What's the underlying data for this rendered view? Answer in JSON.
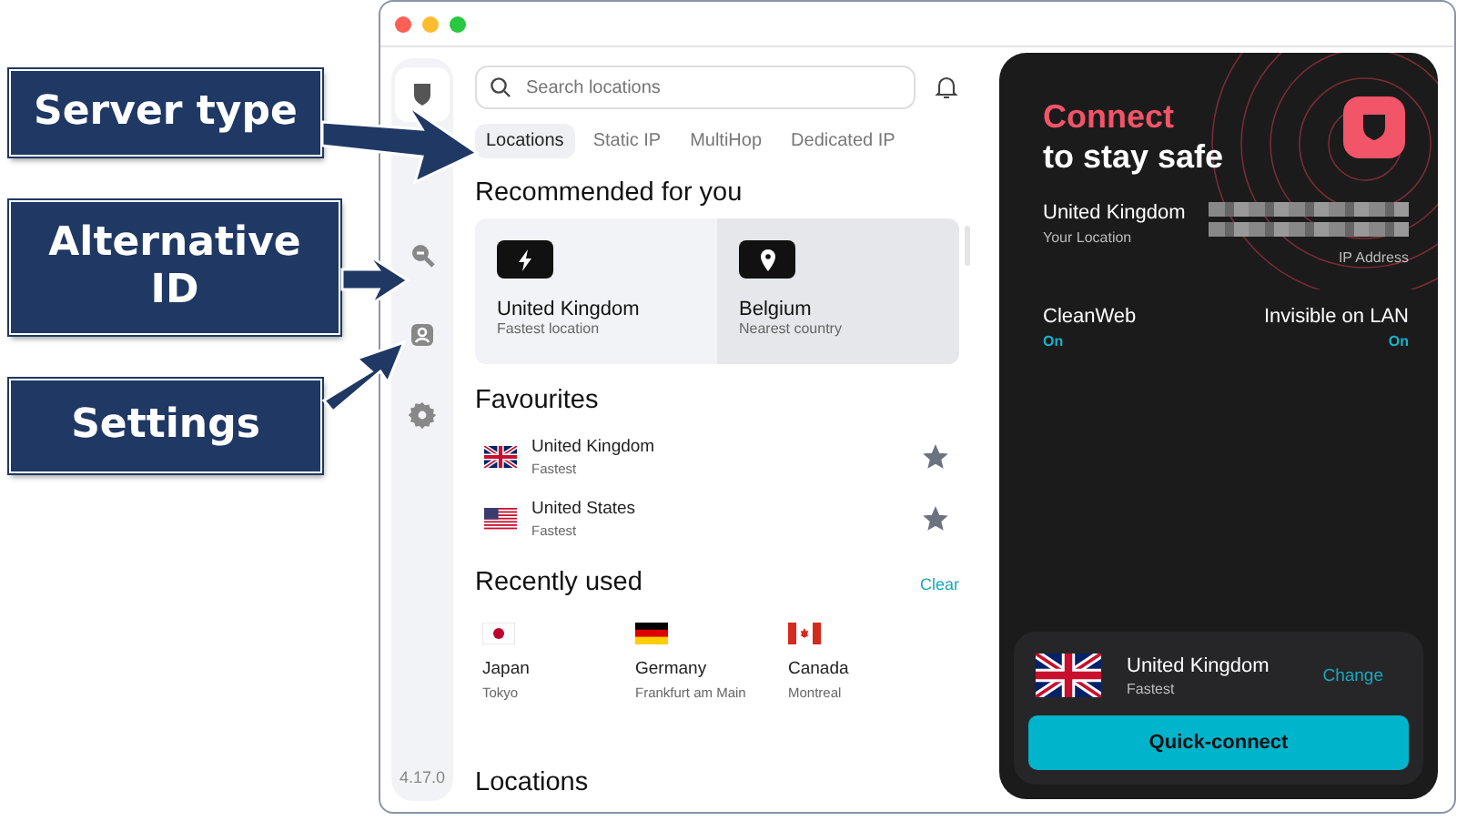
{
  "annotations": [
    {
      "label": "Server type"
    },
    {
      "label": "Alternative ID"
    },
    {
      "label": "Settings"
    }
  ],
  "sidebar": {
    "items": [
      {
        "kind": "shield",
        "selected": true
      },
      {
        "kind": "search",
        "selected": false
      },
      {
        "kind": "id",
        "selected": false
      },
      {
        "kind": "settings",
        "selected": false
      }
    ],
    "version": "4.17.0"
  },
  "search": {
    "placeholder": "Search locations"
  },
  "tabs": [
    {
      "label": "Locations",
      "selected": true
    },
    {
      "label": "Static IP",
      "selected": false
    },
    {
      "label": "MultiHop",
      "selected": false
    },
    {
      "label": "Dedicated IP",
      "selected": false
    }
  ],
  "recommended": {
    "title": "Recommended for you",
    "items": [
      {
        "kind": "fastest",
        "name": "United Kingdom",
        "detail": "Fastest location",
        "selected": false
      },
      {
        "kind": "nearest",
        "name": "Belgium",
        "detail": "Nearest country",
        "selected": true
      }
    ]
  },
  "favourites": {
    "title": "Favourites",
    "items": [
      {
        "kind": "gb",
        "name": "United Kingdom",
        "detail": "Fastest",
        "starred": true
      },
      {
        "kind": "us",
        "name": "United States",
        "detail": "Fastest",
        "starred": true
      }
    ]
  },
  "recently_used": {
    "title": "Recently used",
    "action": "Clear",
    "items": [
      {
        "kind": "jp",
        "name": "Japan",
        "detail": "Tokyo"
      },
      {
        "kind": "de",
        "name": "Germany",
        "detail": "Frankfurt am Main"
      },
      {
        "kind": "ca",
        "name": "Canada",
        "detail": "Montreal"
      }
    ]
  },
  "locations": {
    "title": "Locations"
  },
  "connect_panel": {
    "headline": "Connect",
    "subheadline": "to stay safe",
    "location": "United Kingdom",
    "location_label": "Your Location",
    "ip_label": "IP Address",
    "features": [
      {
        "name": "CleanWeb",
        "status": "On"
      },
      {
        "name": "Invisible on LAN",
        "status": "On"
      }
    ],
    "server": {
      "kind": "gb",
      "name": "United Kingdom",
      "detail": "Fastest",
      "action": "Change"
    },
    "button": "Quick-connect"
  }
}
